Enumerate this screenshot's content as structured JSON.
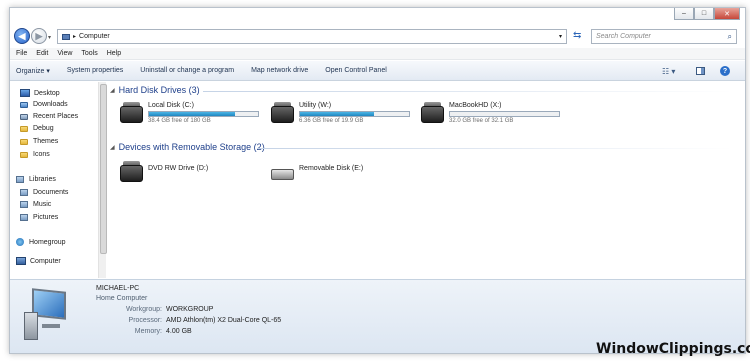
{
  "window": {
    "controls": {
      "minimize": "‒",
      "maximize": "□",
      "close": "✕"
    }
  },
  "address": {
    "path": "Computer",
    "search_placeholder": "Search Computer"
  },
  "menu": [
    "File",
    "Edit",
    "View",
    "Tools",
    "Help"
  ],
  "toolbar": {
    "buttons": [
      "Organize ▾",
      "System properties",
      "Uninstall or change a program",
      "Map network drive",
      "Open Control Panel"
    ]
  },
  "nav": {
    "favorites": [
      "Desktop",
      "Downloads",
      "Recent Places",
      "Debug",
      "Themes",
      "Icons"
    ],
    "libraries_label": "Libraries",
    "libraries": [
      "Documents",
      "Music",
      "Pictures"
    ],
    "homegroup": "Homegroup",
    "computer": "Computer"
  },
  "content": {
    "hard_disk_header": "Hard Disk Drives (3)",
    "removable_header": "Devices with Removable Storage (2)",
    "drives": [
      {
        "name": "Local Disk (C:)",
        "free_text": "38.4 GB free of 180 GB",
        "used_fraction": 0.79
      },
      {
        "name": "Utility (W:)",
        "free_text": "6.36 GB free of 19.9 GB",
        "used_fraction": 0.68
      },
      {
        "name": "MacBookHD (X:)",
        "free_text": "32.0 GB free of 32.1 GB",
        "used_fraction": 0.0
      }
    ],
    "removable": [
      {
        "name": "DVD RW Drive (D:)"
      },
      {
        "name": "Removable Disk (E:)"
      }
    ]
  },
  "details": {
    "computer_name": "MICHAEL-PC",
    "subtitle": "Home Computer",
    "rows": [
      {
        "label": "Workgroup:",
        "value": "WORKGROUP"
      },
      {
        "label": "Processor:",
        "value": "AMD Athlon(tm) X2 Dual-Core QL-65"
      },
      {
        "label": "Memory:",
        "value": "4.00 GB"
      }
    ]
  },
  "watermark": "WindowClippings.com",
  "colors": {
    "accent": "#1e3f8a",
    "bar_fill": "#2a96d1"
  }
}
